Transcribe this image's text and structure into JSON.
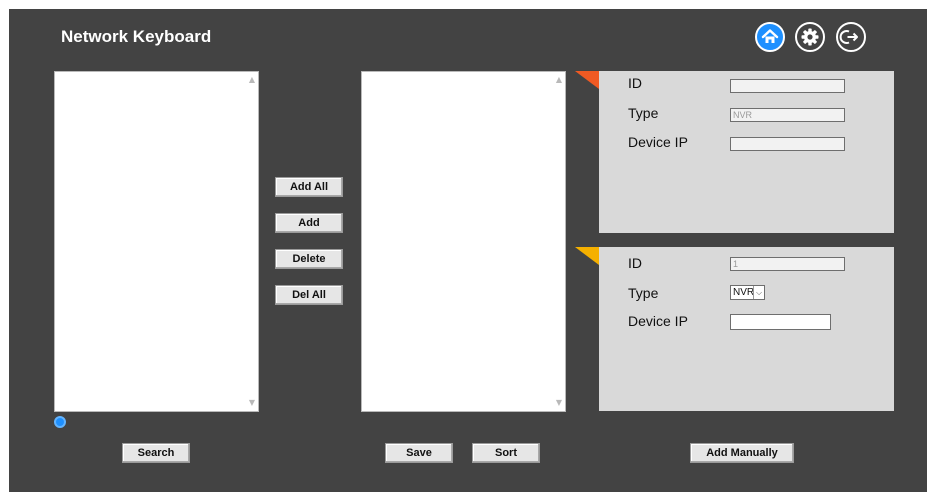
{
  "header": {
    "title": "Network Keyboard",
    "accent_color": "#1e90ff",
    "icons": [
      "home-icon",
      "gear-icon",
      "logout-icon"
    ]
  },
  "middle_buttons": {
    "add_all": "Add All",
    "add": "Add",
    "delete": "Delete",
    "del_all": "Del All"
  },
  "device_info": {
    "corner_color": "#f05a23",
    "id_label": "ID",
    "id_value": "",
    "type_label": "Type",
    "type_value": "NVR",
    "ip_label": "Device IP",
    "ip_value": ""
  },
  "manual_add": {
    "corner_color": "#f5b000",
    "id_label": "ID",
    "id_value": "1",
    "type_label": "Type",
    "type_selected": "NVR",
    "ip_label": "Device IP",
    "ip_value": ""
  },
  "bottom_buttons": {
    "search": "Search",
    "save": "Save",
    "sort": "Sort",
    "add_manually": "Add Manually"
  }
}
